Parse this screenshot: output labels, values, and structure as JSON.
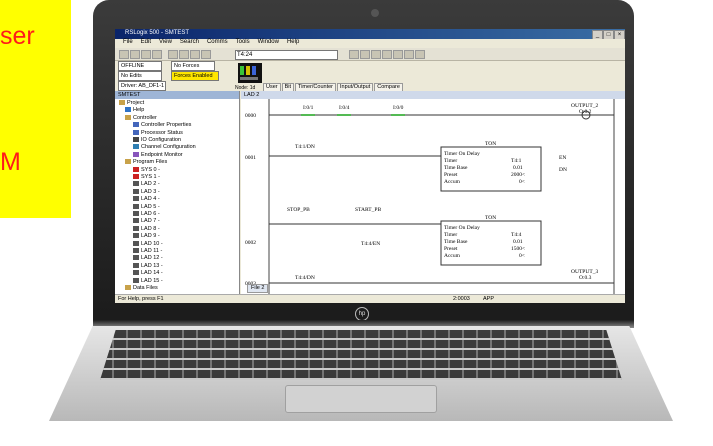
{
  "caption": {
    "line1": "ser",
    "line2": "M",
    "accent_color": "#ff1a1a",
    "background": "#ffff00"
  },
  "app": {
    "title": "RSLogix 500 - SMTEST",
    "menu": [
      "File",
      "Edit",
      "View",
      "Search",
      "Comms",
      "Tools",
      "Window",
      "Help"
    ],
    "address_box": "T4:24",
    "status": {
      "mode": "OFFLINE",
      "forces": "No Forces",
      "edits": "No Edits",
      "forces_enabled": "Forces Enabled",
      "driver": "Driver: AB_DF1-1",
      "node": "Node: 1d"
    },
    "instruction_tabs": [
      "User",
      "Bit",
      "Timer/Counter",
      "Input/Output",
      "Compare"
    ],
    "project_panel_title": "SMTEST",
    "tree": [
      "Project",
      "Help",
      "Controller",
      "Controller Properties",
      "Processor Status",
      "IO Configuration",
      "Channel Configuration",
      "Endpoint Monitor",
      "Program Files",
      "SYS 0 -",
      "SYS 1 -",
      "LAD 2 -",
      "LAD 3 -",
      "LAD 4 -",
      "LAD 5 -",
      "LAD 6 -",
      "LAD 7 -",
      "LAD 8 -",
      "LAD 9 -",
      "LAD 10 -",
      "LAD 11 -",
      "LAD 12 -",
      "LAD 13 -",
      "LAD 14 -",
      "LAD 15 -",
      "Data Files"
    ],
    "ladder_title": "LAD 2",
    "rungs": [
      "0000",
      "0001",
      "0002",
      "0003",
      "0004"
    ],
    "labels": {
      "r0_out": "OUTPUT_2",
      "r0_out_addr": "O:0.2",
      "ton": "TON",
      "timer_on_delay": "Timer On Delay",
      "timer": "Timer",
      "timer_val": "T4:1",
      "time_base": "Time Base",
      "time_base_val": "0.01",
      "preset": "Preset",
      "preset_val": "2000<",
      "accum": "Accum",
      "accum_val": "0<",
      "en": "EN",
      "dn": "DN",
      "stop_pb": "STOP_PB",
      "start_pb": "START_PB",
      "t41dn": "T4:1/DN",
      "t44en": "T4:4/EN",
      "timer2_val": "T4:4",
      "preset2_val": "1500<",
      "out3": "OUTPUT_3",
      "out3_addr": "O:0.3",
      "out4": "OUTPUT_4",
      "out4_addr": "O:0.4",
      "t44dn": "T4:4/DN",
      "addr_i11": "I:0/1",
      "addr_i14": "I:0/4",
      "addr_i10": "I:0/0",
      "file_tab": "File 2"
    },
    "status_bar": "For Help, press F1",
    "status_bar_right": "2:0003",
    "status_bar_app": "APP"
  }
}
